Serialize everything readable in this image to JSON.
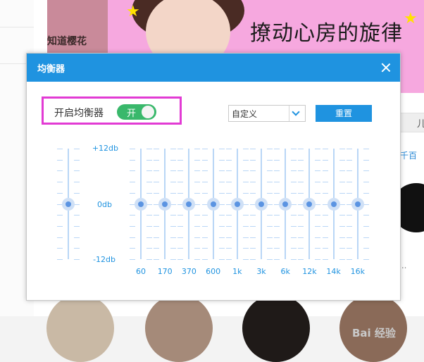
{
  "dialog": {
    "title": "均衡器",
    "toggle_label": "开启均衡器",
    "toggle_state": "开",
    "preset": "自定义",
    "reset_label": "重置"
  },
  "equalizer": {
    "db_labels": [
      "+12db",
      "0db",
      "-12db"
    ],
    "preamp": {
      "value_db": 0
    },
    "bands": [
      {
        "freq": "60",
        "value_db": 0
      },
      {
        "freq": "170",
        "value_db": 0
      },
      {
        "freq": "370",
        "value_db": 0
      },
      {
        "freq": "600",
        "value_db": 0
      },
      {
        "freq": "1k",
        "value_db": 0
      },
      {
        "freq": "3k",
        "value_db": 0
      },
      {
        "freq": "6k",
        "value_db": 0
      },
      {
        "freq": "12k",
        "value_db": 0
      },
      {
        "freq": "14k",
        "value_db": 0
      },
      {
        "freq": "16k",
        "value_db": 0
      }
    ]
  },
  "background": {
    "banner_left_text": "知道樱花",
    "banner_title": "撩动心房的旋律",
    "side_tab_text": "儿",
    "side_link_text": "千百",
    "dots": "..."
  },
  "watermark": "Bai 经验",
  "colors": {
    "accent": "#1f93e0",
    "toggle_on": "#39b86b",
    "highlight": "#e23bd4"
  }
}
